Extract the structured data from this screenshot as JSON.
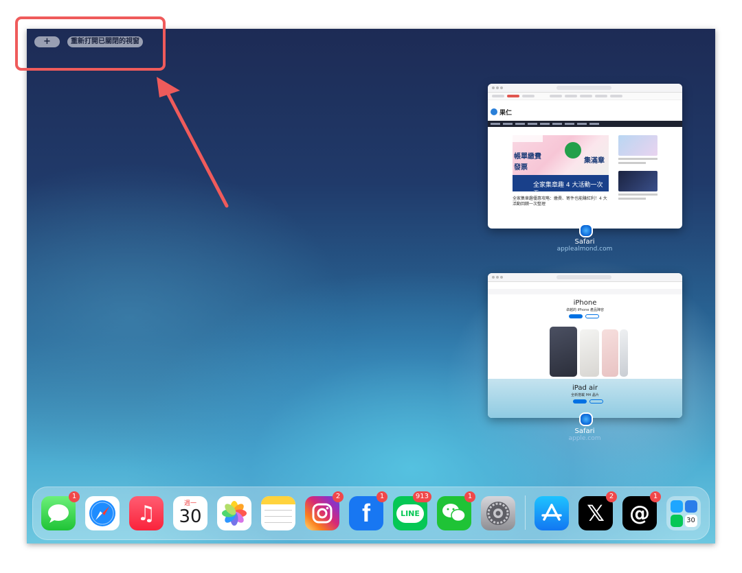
{
  "toolbar": {
    "add_label": "+",
    "reopen_label": "重新打開已關閉的視窗"
  },
  "windows": [
    {
      "app": "Safari",
      "url": "applealmond.com",
      "page": {
        "site_name": "果仁",
        "hero_line1": "帳單繳費",
        "hero_line2": "發票",
        "hero_line3": "集滿章",
        "hero_banner": "全家集章趣 4 大活動一次看",
        "caption": "全家集章趣優惠攻略：繳費、寄件也能賺紅利！4 大活動回饋一次整理"
      }
    },
    {
      "app": "Safari",
      "url": "apple.com",
      "page": {
        "product1": "iPhone",
        "product1_sub": "卓越的 iPhone 產品陣容",
        "product2": "iPad air",
        "product2_sub": "全新搭載 M4 晶片"
      }
    }
  ],
  "dock": {
    "apps": [
      {
        "name": "messages",
        "badge": "1"
      },
      {
        "name": "safari",
        "badge": ""
      },
      {
        "name": "music",
        "badge": ""
      },
      {
        "name": "calendar",
        "badge": "",
        "weekday": "週一",
        "day": "30"
      },
      {
        "name": "photos",
        "badge": ""
      },
      {
        "name": "notes",
        "badge": ""
      },
      {
        "name": "instagram",
        "badge": "2"
      },
      {
        "name": "facebook",
        "badge": "1",
        "glyph": "f"
      },
      {
        "name": "line",
        "badge": "913",
        "glyph": "LINE"
      },
      {
        "name": "wechat",
        "badge": "1"
      },
      {
        "name": "settings",
        "badge": ""
      },
      {
        "name": "app-store",
        "badge": ""
      },
      {
        "name": "x",
        "badge": "2",
        "glyph": "𝕏"
      },
      {
        "name": "threads",
        "badge": "1",
        "glyph": "@"
      },
      {
        "name": "app-library",
        "badge": "",
        "day": "30"
      }
    ]
  },
  "colors": {
    "highlight": "#ef5b5b",
    "badge": "#f0484a"
  }
}
